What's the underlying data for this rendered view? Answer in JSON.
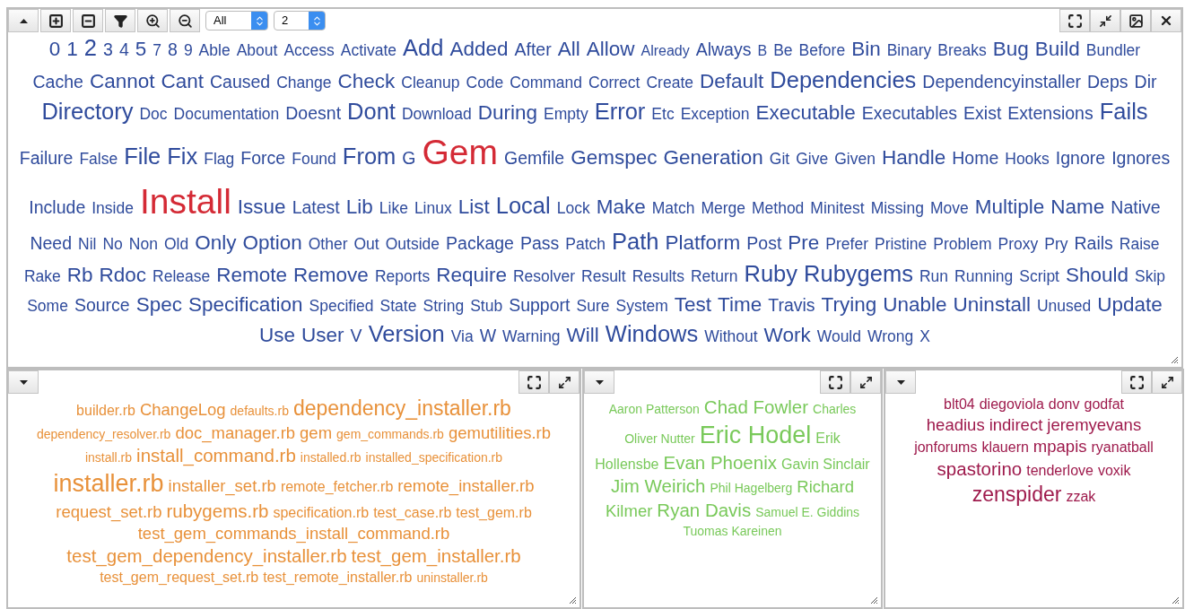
{
  "toolbar": {
    "selects": [
      {
        "value": "All"
      },
      {
        "value": "2"
      }
    ]
  },
  "clouds": [
    {
      "kind": "main",
      "color": "#2f4b9c",
      "lines": [
        [
          {
            "text": "0",
            "kind": "large"
          },
          {
            "text": "1",
            "kind": "large"
          },
          {
            "text": "2",
            "kind": "huge"
          },
          {
            "text": "3",
            "kind": "medium"
          },
          {
            "text": "4",
            "kind": "medium"
          },
          {
            "text": "5",
            "kind": "large"
          },
          {
            "text": "7",
            "kind": "small"
          },
          {
            "text": "8",
            "kind": "medium"
          },
          {
            "text": "9",
            "kind": "small"
          },
          {
            "text": "Able",
            "kind": "small"
          },
          {
            "text": "About",
            "kind": "small"
          },
          {
            "text": "Access",
            "kind": "small"
          },
          {
            "text": "Activate",
            "kind": "small"
          },
          {
            "text": "Add",
            "kind": "huge"
          },
          {
            "text": "Added",
            "kind": "large"
          },
          {
            "text": "After",
            "kind": "medium"
          },
          {
            "text": "All",
            "kind": "large"
          },
          {
            "text": "Allow",
            "kind": "large"
          },
          {
            "text": "Already",
            "kind": "tiny"
          },
          {
            "text": "Always",
            "kind": "medium"
          },
          {
            "text": "B",
            "kind": "tiny"
          },
          {
            "text": "Be",
            "kind": "small"
          },
          {
            "text": "Before",
            "kind": "small"
          },
          {
            "text": "Bin",
            "kind": "large"
          },
          {
            "text": "Binary",
            "kind": "small"
          },
          {
            "text": "Breaks",
            "kind": "small"
          },
          {
            "text": "Bug",
            "kind": "large"
          },
          {
            "text": "Build",
            "kind": "large"
          },
          {
            "text": "Bundler",
            "kind": "small"
          }
        ],
        [
          {
            "text": "Cache",
            "kind": "medium"
          },
          {
            "text": "Cannot",
            "kind": "large"
          },
          {
            "text": "Cant",
            "kind": "large"
          },
          {
            "text": "Caused",
            "kind": "medium"
          },
          {
            "text": "Change",
            "kind": "small"
          },
          {
            "text": "Check",
            "kind": "large"
          },
          {
            "text": "Cleanup",
            "kind": "small"
          },
          {
            "text": "Code",
            "kind": "small"
          },
          {
            "text": "Command",
            "kind": "small"
          },
          {
            "text": "Correct",
            "kind": "small"
          },
          {
            "text": "Create",
            "kind": "small"
          },
          {
            "text": "Default",
            "kind": "large"
          },
          {
            "text": "Dependencies",
            "kind": "huge"
          },
          {
            "text": "Dependencyinstaller",
            "kind": "medium"
          },
          {
            "text": "Deps",
            "kind": "medium"
          },
          {
            "text": "Dir",
            "kind": "medium"
          }
        ],
        [
          {
            "text": "Directory",
            "kind": "huge"
          },
          {
            "text": "Doc",
            "kind": "small"
          },
          {
            "text": "Documentation",
            "kind": "small"
          },
          {
            "text": "Doesnt",
            "kind": "medium"
          },
          {
            "text": "Dont",
            "kind": "huge"
          },
          {
            "text": "Download",
            "kind": "small"
          },
          {
            "text": "During",
            "kind": "large"
          },
          {
            "text": "Empty",
            "kind": "small"
          },
          {
            "text": "Error",
            "kind": "huge"
          },
          {
            "text": "Etc",
            "kind": "small"
          },
          {
            "text": "Exception",
            "kind": "small"
          },
          {
            "text": "Executable",
            "kind": "large"
          },
          {
            "text": "Executables",
            "kind": "medium"
          },
          {
            "text": "Exist",
            "kind": "medium"
          },
          {
            "text": "Extensions",
            "kind": "medium"
          },
          {
            "text": "Fails",
            "kind": "huge"
          }
        ],
        [
          {
            "text": "Failure",
            "kind": "medium"
          },
          {
            "text": "False",
            "kind": "small"
          },
          {
            "text": "File",
            "kind": "huge"
          },
          {
            "text": "Fix",
            "kind": "huge"
          },
          {
            "text": "Flag",
            "kind": "small"
          },
          {
            "text": "Force",
            "kind": "medium"
          },
          {
            "text": "Found",
            "kind": "small"
          },
          {
            "text": "From",
            "kind": "huge"
          },
          {
            "text": "G",
            "kind": "medium"
          },
          {
            "text": "Gem",
            "kind": "giant",
            "color": "#d42a35"
          },
          {
            "text": "Gemfile",
            "kind": "medium"
          },
          {
            "text": "Gemspec",
            "kind": "large"
          },
          {
            "text": "Generation",
            "kind": "large"
          },
          {
            "text": "Git",
            "kind": "small"
          },
          {
            "text": "Give",
            "kind": "small"
          },
          {
            "text": "Given",
            "kind": "small"
          },
          {
            "text": "Handle",
            "kind": "large"
          },
          {
            "text": "Home",
            "kind": "medium"
          },
          {
            "text": "Hooks",
            "kind": "small"
          },
          {
            "text": "Ignore",
            "kind": "medium"
          },
          {
            "text": "Ignores",
            "kind": "medium"
          }
        ],
        [
          {
            "text": "Include",
            "kind": "medium"
          },
          {
            "text": "Inside",
            "kind": "small"
          },
          {
            "text": "Install",
            "kind": "giant",
            "color": "#d42a35"
          },
          {
            "text": "Issue",
            "kind": "large"
          },
          {
            "text": "Latest",
            "kind": "medium"
          },
          {
            "text": "Lib",
            "kind": "large"
          },
          {
            "text": "Like",
            "kind": "small"
          },
          {
            "text": "Linux",
            "kind": "small"
          },
          {
            "text": "List",
            "kind": "large"
          },
          {
            "text": "Local",
            "kind": "huge"
          },
          {
            "text": "Lock",
            "kind": "small"
          },
          {
            "text": "Make",
            "kind": "large"
          },
          {
            "text": "Match",
            "kind": "small"
          },
          {
            "text": "Merge",
            "kind": "small"
          },
          {
            "text": "Method",
            "kind": "small"
          },
          {
            "text": "Minitest",
            "kind": "small"
          },
          {
            "text": "Missing",
            "kind": "small"
          },
          {
            "text": "Move",
            "kind": "small"
          },
          {
            "text": "Multiple",
            "kind": "large"
          },
          {
            "text": "Name",
            "kind": "large"
          },
          {
            "text": "Native",
            "kind": "medium"
          }
        ],
        [
          {
            "text": "Need",
            "kind": "medium"
          },
          {
            "text": "Nil",
            "kind": "small"
          },
          {
            "text": "No",
            "kind": "small"
          },
          {
            "text": "Non",
            "kind": "small"
          },
          {
            "text": "Old",
            "kind": "small"
          },
          {
            "text": "Only",
            "kind": "large"
          },
          {
            "text": "Option",
            "kind": "large"
          },
          {
            "text": "Other",
            "kind": "small"
          },
          {
            "text": "Out",
            "kind": "small"
          },
          {
            "text": "Outside",
            "kind": "small"
          },
          {
            "text": "Package",
            "kind": "medium"
          },
          {
            "text": "Pass",
            "kind": "medium"
          },
          {
            "text": "Patch",
            "kind": "small"
          },
          {
            "text": "Path",
            "kind": "huge"
          },
          {
            "text": "Platform",
            "kind": "large"
          },
          {
            "text": "Post",
            "kind": "medium"
          },
          {
            "text": "Pre",
            "kind": "large"
          },
          {
            "text": "Prefer",
            "kind": "small"
          },
          {
            "text": "Pristine",
            "kind": "small"
          },
          {
            "text": "Problem",
            "kind": "small"
          },
          {
            "text": "Proxy",
            "kind": "small"
          },
          {
            "text": "Pry",
            "kind": "small"
          },
          {
            "text": "Rails",
            "kind": "medium"
          },
          {
            "text": "Raise",
            "kind": "small"
          }
        ],
        [
          {
            "text": "Rake",
            "kind": "small"
          },
          {
            "text": "Rb",
            "kind": "large"
          },
          {
            "text": "Rdoc",
            "kind": "large"
          },
          {
            "text": "Release",
            "kind": "small"
          },
          {
            "text": "Remote",
            "kind": "large"
          },
          {
            "text": "Remove",
            "kind": "large"
          },
          {
            "text": "Reports",
            "kind": "small"
          },
          {
            "text": "Require",
            "kind": "large"
          },
          {
            "text": "Resolver",
            "kind": "small"
          },
          {
            "text": "Result",
            "kind": "small"
          },
          {
            "text": "Results",
            "kind": "small"
          },
          {
            "text": "Return",
            "kind": "small"
          },
          {
            "text": "Ruby",
            "kind": "huge"
          },
          {
            "text": "Rubygems",
            "kind": "huge"
          },
          {
            "text": "Run",
            "kind": "small"
          },
          {
            "text": "Running",
            "kind": "small"
          },
          {
            "text": "Script",
            "kind": "small"
          },
          {
            "text": "Should",
            "kind": "large"
          },
          {
            "text": "Skip",
            "kind": "small"
          }
        ],
        [
          {
            "text": "Some",
            "kind": "small"
          },
          {
            "text": "Source",
            "kind": "medium"
          },
          {
            "text": "Spec",
            "kind": "large"
          },
          {
            "text": "Specification",
            "kind": "large"
          },
          {
            "text": "Specified",
            "kind": "small"
          },
          {
            "text": "State",
            "kind": "small"
          },
          {
            "text": "String",
            "kind": "small"
          },
          {
            "text": "Stub",
            "kind": "small"
          },
          {
            "text": "Support",
            "kind": "medium"
          },
          {
            "text": "Sure",
            "kind": "small"
          },
          {
            "text": "System",
            "kind": "small"
          },
          {
            "text": "Test",
            "kind": "large"
          },
          {
            "text": "Time",
            "kind": "large"
          },
          {
            "text": "Travis",
            "kind": "medium"
          },
          {
            "text": "Trying",
            "kind": "large"
          },
          {
            "text": "Unable",
            "kind": "large"
          },
          {
            "text": "Uninstall",
            "kind": "large"
          },
          {
            "text": "Unused",
            "kind": "small"
          },
          {
            "text": "Update",
            "kind": "large"
          }
        ],
        [
          {
            "text": "Use",
            "kind": "large"
          },
          {
            "text": "User",
            "kind": "large"
          },
          {
            "text": "V",
            "kind": "medium"
          },
          {
            "text": "Version",
            "kind": "huge"
          },
          {
            "text": "Via",
            "kind": "small"
          },
          {
            "text": "W",
            "kind": "medium"
          },
          {
            "text": "Warning",
            "kind": "small"
          },
          {
            "text": "Will",
            "kind": "large"
          },
          {
            "text": "Windows",
            "kind": "huge"
          },
          {
            "text": "Without",
            "kind": "small"
          },
          {
            "text": "Work",
            "kind": "large"
          },
          {
            "text": "Would",
            "kind": "small"
          },
          {
            "text": "Wrong",
            "kind": "small"
          },
          {
            "text": "X",
            "kind": "small"
          }
        ]
      ]
    },
    {
      "kind": "files",
      "color": "#e8913a",
      "lines": [
        [
          {
            "text": "builder.rb",
            "kind": "small"
          },
          {
            "text": "ChangeLog",
            "kind": "medium"
          },
          {
            "text": "defaults.rb",
            "kind": "tiny"
          },
          {
            "text": "dependency_installer.rb",
            "kind": "huge"
          }
        ],
        [
          {
            "text": "dependency_resolver.rb",
            "kind": "tiny"
          },
          {
            "text": "doc_manager.rb",
            "kind": "medium"
          },
          {
            "text": "gem",
            "kind": "medium"
          },
          {
            "text": "gem_commands.rb",
            "kind": "tiny"
          },
          {
            "text": "gemutilities.rb",
            "kind": "medium"
          }
        ],
        [
          {
            "text": "install.rb",
            "kind": "tiny"
          },
          {
            "text": "install_command.rb",
            "kind": "large"
          },
          {
            "text": "installed.rb",
            "kind": "tiny"
          },
          {
            "text": "installed_specification.rb",
            "kind": "tiny"
          }
        ],
        [
          {
            "text": "installer.rb",
            "kind": "giant"
          },
          {
            "text": "installer_set.rb",
            "kind": "medium"
          },
          {
            "text": "remote_fetcher.rb",
            "kind": "small"
          },
          {
            "text": "remote_installer.rb",
            "kind": "medium"
          }
        ],
        [
          {
            "text": "request_set.rb",
            "kind": "medium"
          },
          {
            "text": "rubygems.rb",
            "kind": "large"
          },
          {
            "text": "specification.rb",
            "kind": "small"
          },
          {
            "text": "test_case.rb",
            "kind": "small"
          },
          {
            "text": "test_gem.rb",
            "kind": "small"
          }
        ],
        [
          {
            "text": "test_gem_commands_install_command.rb",
            "kind": "medium"
          }
        ],
        [
          {
            "text": "test_gem_dependency_installer.rb",
            "kind": "large"
          },
          {
            "text": "test_gem_installer.rb",
            "kind": "large"
          }
        ],
        [
          {
            "text": "test_gem_request_set.rb",
            "kind": "small"
          },
          {
            "text": "test_remote_installer.rb",
            "kind": "small"
          },
          {
            "text": "uninstaller.rb",
            "kind": "tiny"
          }
        ]
      ]
    },
    {
      "kind": "authors",
      "color": "#79c95a",
      "lines": [
        [
          {
            "text": "Aaron Patterson",
            "kind": "tiny"
          },
          {
            "text": "Chad Fowler",
            "kind": "large"
          },
          {
            "text": "Charles",
            "kind": "tiny"
          }
        ],
        [
          {
            "text": "Oliver Nutter",
            "kind": "tiny"
          },
          {
            "text": "Eric Hodel",
            "kind": "giant"
          },
          {
            "text": "Erik",
            "kind": "small"
          }
        ],
        [
          {
            "text": "Hollensbe",
            "kind": "small"
          },
          {
            "text": "Evan Phoenix",
            "kind": "large"
          },
          {
            "text": "Gavin Sinclair",
            "kind": "small"
          }
        ],
        [
          {
            "text": "Jim Weirich",
            "kind": "large"
          },
          {
            "text": "Phil Hagelberg",
            "kind": "tiny"
          },
          {
            "text": "Richard",
            "kind": "medium"
          }
        ],
        [
          {
            "text": "Kilmer",
            "kind": "medium"
          },
          {
            "text": "Ryan Davis",
            "kind": "large"
          },
          {
            "text": "Samuel E. Giddins",
            "kind": "tiny"
          }
        ],
        [
          {
            "text": "Tuomas Kareinen",
            "kind": "tiny"
          }
        ]
      ]
    },
    {
      "kind": "users",
      "color": "#9e1a4c",
      "lines": [
        [
          {
            "text": "blt04",
            "kind": "small"
          },
          {
            "text": "diegoviola",
            "kind": "small"
          },
          {
            "text": "donv",
            "kind": "small"
          },
          {
            "text": "godfat",
            "kind": "small"
          }
        ],
        [
          {
            "text": "headius",
            "kind": "medium"
          },
          {
            "text": "indirect",
            "kind": "medium"
          },
          {
            "text": "jeremyevans",
            "kind": "medium"
          }
        ],
        [
          {
            "text": "jonforums",
            "kind": "small"
          },
          {
            "text": "klauern",
            "kind": "small"
          },
          {
            "text": "mpapis",
            "kind": "medium"
          },
          {
            "text": "ryanatball",
            "kind": "small"
          }
        ],
        [
          {
            "text": "spastorino",
            "kind": "large"
          },
          {
            "text": "tenderlove",
            "kind": "small"
          },
          {
            "text": "voxik",
            "kind": "small"
          }
        ],
        [
          {
            "text": "zenspider",
            "kind": "huge"
          },
          {
            "text": "zzak",
            "kind": "small"
          }
        ]
      ]
    }
  ]
}
